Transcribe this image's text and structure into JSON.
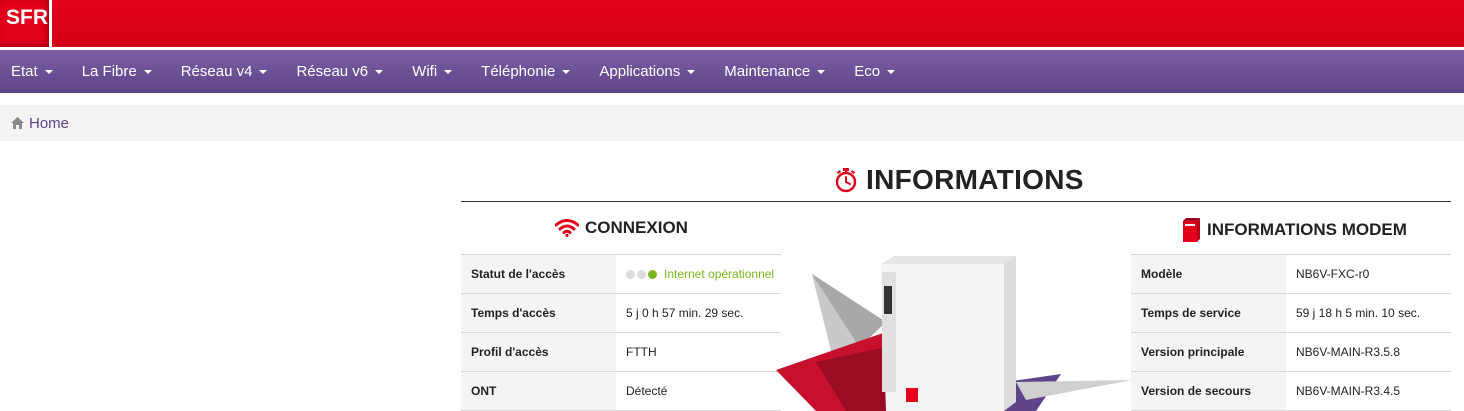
{
  "header": {
    "logo_text": "SFR",
    "brand_color": "#e2001a"
  },
  "nav": {
    "items": [
      {
        "label": "Etat"
      },
      {
        "label": "La Fibre"
      },
      {
        "label": "Réseau v4"
      },
      {
        "label": "Réseau v6"
      },
      {
        "label": "Wifi"
      },
      {
        "label": "Téléphonie"
      },
      {
        "label": "Applications"
      },
      {
        "label": "Maintenance"
      },
      {
        "label": "Eco"
      }
    ],
    "color": "#6b4f96"
  },
  "breadcrumb": {
    "home_label": "Home"
  },
  "main": {
    "title": "INFORMATIONS",
    "connexion": {
      "title": "CONNEXION",
      "rows": [
        {
          "key": "Statut de l'accès",
          "value": "Internet opérationnel"
        },
        {
          "key": "Temps d'accès",
          "value": "5 j 0 h 57 min. 29 sec."
        },
        {
          "key": "Profil d'accès",
          "value": "FTTH"
        },
        {
          "key": "ONT",
          "value": "Détecté"
        }
      ],
      "status_color": "#7ab51d"
    },
    "modem": {
      "title": "INFORMATIONS MODEM",
      "rows": [
        {
          "key": "Modèle",
          "value": "NB6V-FXC-r0"
        },
        {
          "key": "Temps de service",
          "value": "59 j 18 h 5 min. 10 sec."
        },
        {
          "key": "Version principale",
          "value": "NB6V-MAIN-R3.5.8"
        },
        {
          "key": "Version de secours",
          "value": "NB6V-MAIN-R3.4.5"
        }
      ]
    }
  }
}
